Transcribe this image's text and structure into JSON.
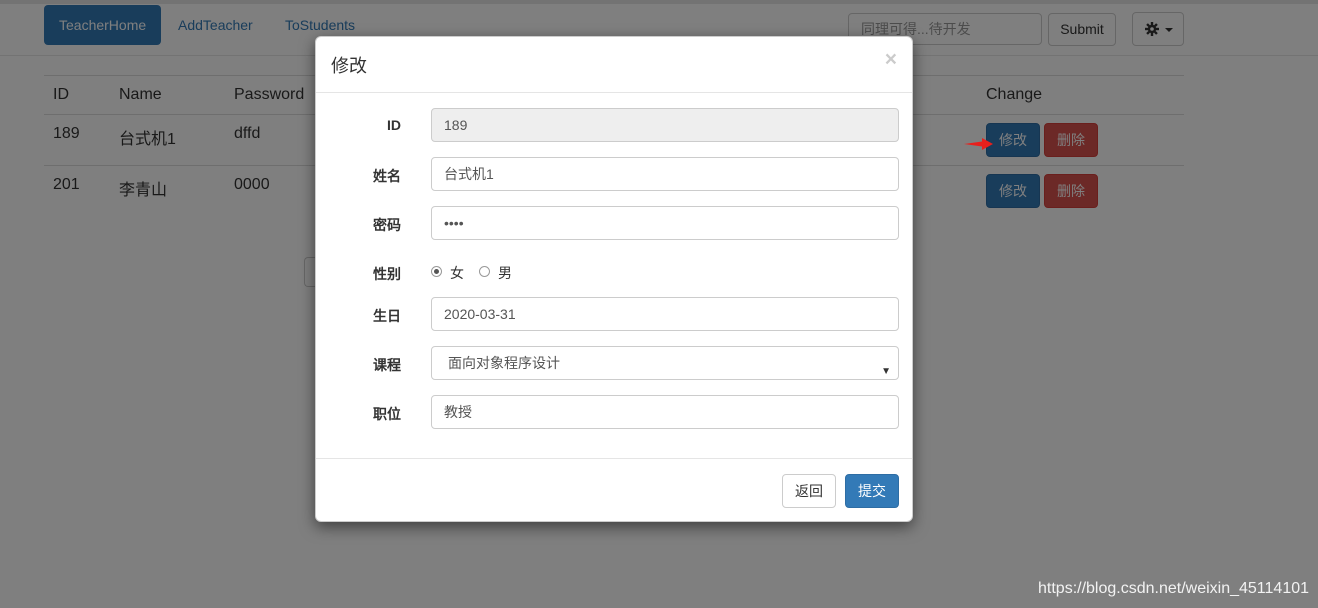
{
  "navbar": {
    "brand_tab": "TeacherHome",
    "links": [
      "AddTeacher",
      "ToStudents"
    ],
    "search_placeholder": "同理可得...待开发",
    "submit_label": "Submit",
    "settings_icon": "gear-icon"
  },
  "table": {
    "headers": {
      "id": "ID",
      "name": "Name",
      "password": "Password",
      "change": "Change"
    },
    "rows": [
      {
        "id": "189",
        "name": "台式机1",
        "password": "dffd",
        "edit": "修改",
        "delete": "删除"
      },
      {
        "id": "201",
        "name": "李青山",
        "password": "0000",
        "edit": "修改",
        "delete": "删除"
      }
    ]
  },
  "modal": {
    "title": "修改",
    "close": "×",
    "fields": {
      "id_label": "ID",
      "id_value": "189",
      "name_label": "姓名",
      "name_value": "台式机1",
      "password_label": "密码",
      "password_value": "••••",
      "gender_label": "性别",
      "gender_female": "女",
      "gender_male": "男",
      "gender_selected": "女",
      "birthday_label": "生日",
      "birthday_value": "2020-03-31",
      "course_label": "课程",
      "course_value": "面向对象程序设计",
      "position_label": "职位",
      "position_value": "教授"
    },
    "back_label": "返回",
    "submit_label": "提交"
  },
  "watermark": "https://blog.csdn.net/weixin_45114101",
  "colors": {
    "primary": "#337ab7",
    "danger": "#d9534f",
    "backdrop": "rgba(0,0,0,0.5)"
  }
}
